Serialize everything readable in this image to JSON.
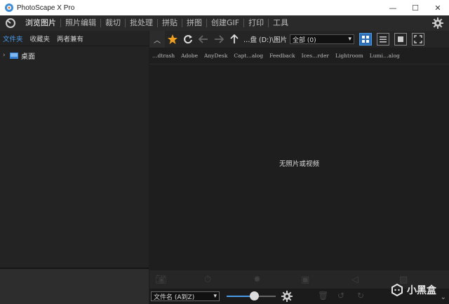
{
  "window": {
    "title": "PhotoScape X Pro",
    "controls": {
      "minimize": "—",
      "maximize": "☐",
      "close": "✕"
    }
  },
  "menu": {
    "items": [
      "浏览图片",
      "照片编辑",
      "裁切",
      "批处理",
      "拼贴",
      "拼图",
      "创建GIF",
      "打印",
      "工具"
    ],
    "active_index": 0
  },
  "sidebar": {
    "tabs": [
      "文件夹",
      "收藏夹",
      "两者兼有"
    ],
    "active_tab": 0,
    "tree": [
      {
        "label": "桌面",
        "expand_glyph": "›"
      }
    ]
  },
  "toolbar": {
    "up_glyph": "︿",
    "path": "…盘 (D:)\\图片",
    "filter": {
      "value": "全部 (0)",
      "arrow": "▾"
    }
  },
  "folder_strip": [
    "…dtrash",
    "Adobe",
    "AnyDesk",
    "Capt…alog",
    "Feedback",
    "Ices…rder",
    "Lightroom",
    "Lumi…alog"
  ],
  "content": {
    "empty_message": "无照片或视频"
  },
  "footer": {
    "sort": {
      "value": "文件名 (A到Z)",
      "arrow": "▾"
    },
    "thumbnail_size_fraction": 0.55
  },
  "collapse_handle": "‹",
  "watermark": {
    "text": "小黑盒"
  },
  "colors": {
    "accent": "#4a9be8",
    "star": "#f0a020",
    "view_active": "#2f6fb3"
  }
}
